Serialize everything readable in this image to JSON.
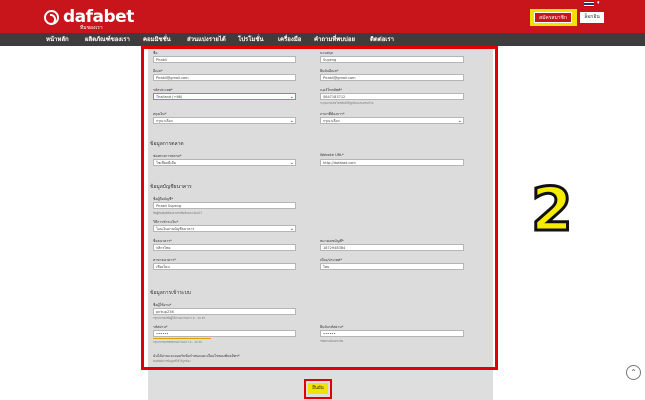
{
  "header": {
    "brand": "dafabet",
    "brand_sub": "ทีมของเรา",
    "signup_label": "สมัครสมาชิก",
    "login_label": "ล็อกอิน",
    "flag_icon": "thai-flag-icon",
    "brand_color": "#c8141b"
  },
  "nav": {
    "items": [
      {
        "label": "หน้าหลัก"
      },
      {
        "label": "ผลิตภัณฑ์ของเรา"
      },
      {
        "label": "คอมมิชชั่น"
      },
      {
        "label": "ส่วนแบ่งรายได้"
      },
      {
        "label": "โปรโมชั่น"
      },
      {
        "label": "เครื่องมือ"
      },
      {
        "label": "คำถามที่พบบ่อย"
      },
      {
        "label": "ติดต่อเรา"
      }
    ]
  },
  "form": {
    "first_name": {
      "label": "ชื่อ",
      "value": "Pirabil"
    },
    "last_name": {
      "label": "นามสกุล",
      "value": "Supeng"
    },
    "email": {
      "label": "อีเมล*",
      "value": "Pirabil@gmail.com"
    },
    "confirm_email": {
      "label": "ยืนยันอีเมล*",
      "value": "Pirabil@gmail.com"
    },
    "country_code": {
      "label": "รหัสประเทศ*",
      "value": "Thailand (+66)"
    },
    "phone": {
      "label": "เบอร์โทรศัพท์*",
      "value": "0847183712",
      "hint": "ระบุหมายเลขโทรศัพท์ให้ถูกต้องและครบถ้วน"
    },
    "currency": {
      "label": "สกุลเงิน*",
      "value": "กรุณาเลือก"
    },
    "language": {
      "label": "ภาษาที่ต้องการ*",
      "value": "กรุณาเลือก"
    },
    "marketing_section": "ข้อมูลการตลาด",
    "marketing_channel": {
      "label": "ช่องทางการตลาด*",
      "value": "โซเชียลมีเดีย"
    },
    "website": {
      "label": "Website URL*",
      "value": "http://dafabet.com"
    },
    "bank_section": "ข้อมูลบัญชีธนาคาร",
    "account_name": {
      "label": "ชื่อผู้ถือบัญชี*",
      "value": "Pirabil Supeng",
      "hint": "ชื่อผู้ถือบัญชีต้องตรงกับชื่อที่ลงทะเบียนไว้"
    },
    "payment_method": {
      "label": "วิธีการชำระเงิน*",
      "value": "โอนเงินผ่านบัญชีธนาคาร"
    },
    "bank_name": {
      "label": "ชื่อธนาคาร*",
      "value": "กสิกรไทย"
    },
    "account_number": {
      "label": "หมายเลขบัญชี*",
      "value": "1872948384"
    },
    "bank_branch": {
      "label": "สาขาธนาคาร*",
      "value": "เชียงใหม่"
    },
    "bank_country": {
      "label": "เมือง/ประเทศ*",
      "value": "ไทย"
    },
    "login_section": "ข้อมูลการเข้าระบบ",
    "username": {
      "label": "ชื่อผู้ใช้งาน*",
      "value": "pirkup238",
      "hint": "กรุณากรอกชื่อผู้ใช้งานความยาว 6 - 16 ตัว"
    },
    "password": {
      "label": "รหัสผ่าน*",
      "value": "••••••",
      "hint": "กรุณากรอกรหัสผ่านความยาว 6 - 20 ตัว"
    },
    "confirm_password": {
      "label": "ยืนยันรหัสผ่าน*",
      "value": "••••••",
      "hint": "รหัสผ่านต้องตรงกัน"
    },
    "terms": {
      "label": "ฉันได้อ่านและยอมรับข้อกำหนดและเงื่อนไขของพันธมิตร*",
      "sub": "ฉันยืนยันว่าข้อมูลที่ให้ไว้ถูกต้อง"
    }
  },
  "submit_label": "ยืนยัน",
  "step_number": "2",
  "highlight_color": "#e00000",
  "accent_yellow": "#f2e200"
}
